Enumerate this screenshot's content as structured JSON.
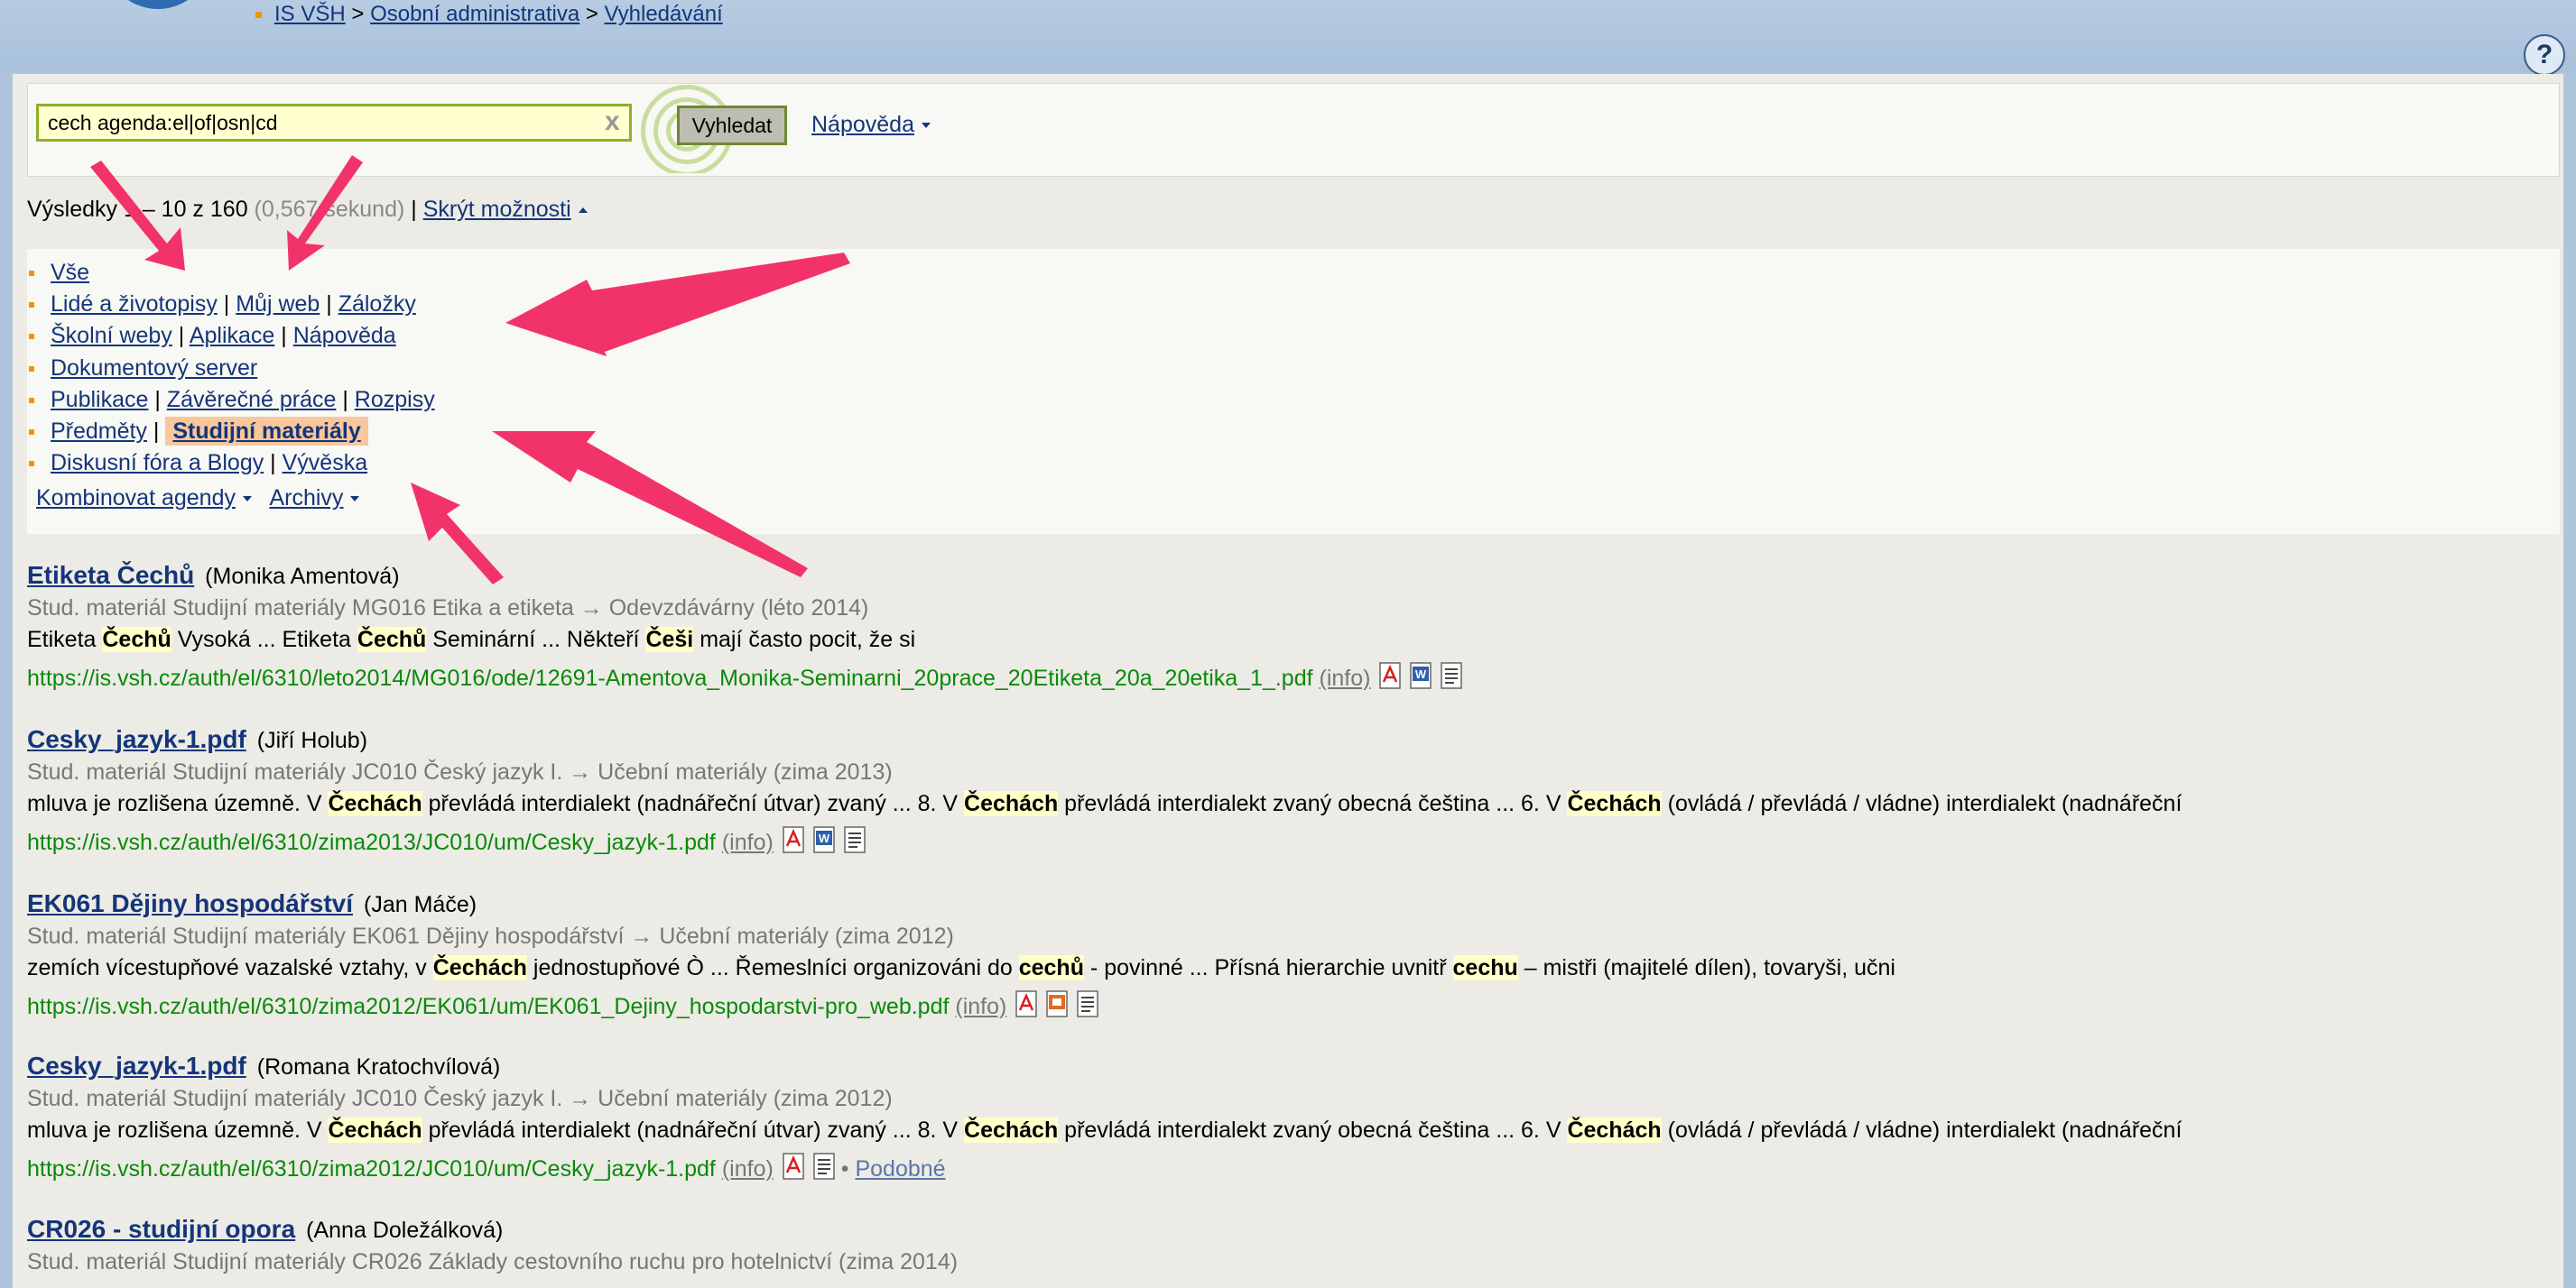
{
  "breadcrumb": {
    "items": [
      "IS VŠH",
      "Osobní administrativa",
      "Vyhledávání"
    ],
    "sep": ">"
  },
  "help_icon": "question-mark-icon",
  "search": {
    "value": "cech agenda:el|of|osn|cd",
    "clear": "x",
    "button": "Vyhledat",
    "help": "Nápověda"
  },
  "results_info": {
    "prefix": "Výsledky 1 – 10 z 160",
    "time": "(0,567 sekund)",
    "sep": "|",
    "toggle": "Skrýt možnosti"
  },
  "options": [
    {
      "links": [
        "Vše"
      ]
    },
    {
      "links": [
        "Lidé a životopisy",
        "Můj web",
        "Záložky"
      ]
    },
    {
      "links": [
        "Školní weby",
        "Aplikace",
        "Nápověda"
      ]
    },
    {
      "links": [
        "Dokumentový server"
      ]
    },
    {
      "links": [
        "Publikace",
        "Závěrečné práce",
        "Rozpisy"
      ]
    },
    {
      "links": [
        "Předměty",
        "Studijní materiály"
      ],
      "active": "Studijní materiály"
    },
    {
      "links": [
        "Diskusní fóra a Blogy",
        "Vývěska"
      ]
    }
  ],
  "combo": {
    "combine": "Kombinovat agendy",
    "archives": "Archivy"
  },
  "results": [
    {
      "title": "Etiketa Čechů",
      "author": "(Monika Amentová)",
      "meta": "Stud. materiál Studijní materiály MG016 Etika a etiketa → Odevzdávárny (léto 2014)",
      "snippet": [
        [
          "Etiketa ",
          false
        ],
        [
          "Čechů",
          true
        ],
        [
          " Vysoká ... Etiketa ",
          false
        ],
        [
          "Čechů",
          true
        ],
        [
          " Seminární ... Někteří ",
          false
        ],
        [
          "Češi",
          true
        ],
        [
          " mají často pocit, že si",
          false
        ]
      ],
      "url": "https://is.vsh.cz/auth/el/6310/leto2014/MG016/ode/12691-Amentova_Monika-Seminarni_20prace_20Etiketa_20a_20etika_1_.pdf",
      "info": "(info)",
      "icons": [
        "pdf-icon",
        "word-icon",
        "text-icon"
      ],
      "similar": ""
    },
    {
      "title": "Cesky_jazyk-1.pdf",
      "author": "(Jiří Holub)",
      "meta": "Stud. materiál Studijní materiály JC010 Český jazyk I. → Učební materiály (zima 2013)",
      "snippet": [
        [
          "mluva je rozlišena územně. V ",
          false
        ],
        [
          "Čechách",
          true
        ],
        [
          " převládá interdialekt (nadnářeční útvar) zvaný ... 8. V ",
          false
        ],
        [
          "Čechách",
          true
        ],
        [
          " převládá interdialekt zvaný obecná čeština ... 6. V ",
          false
        ],
        [
          "Čechách",
          true
        ],
        [
          " (ovládá / převládá / vládne) interdialekt (nadnářeční",
          false
        ]
      ],
      "url": "https://is.vsh.cz/auth/el/6310/zima2013/JC010/um/Cesky_jazyk-1.pdf",
      "info": "(info)",
      "icons": [
        "pdf-icon",
        "word-icon",
        "text-icon"
      ],
      "similar": ""
    },
    {
      "title": "EK061 Dějiny hospodářství",
      "author": "(Jan Máče)",
      "meta": "Stud. materiál Studijní materiály EK061 Dějiny hospodářství → Učební materiály (zima 2012)",
      "snippet": [
        [
          "zemích vícestupňové vazalské vztahy, v ",
          false
        ],
        [
          "Čechách",
          true
        ],
        [
          " jednostupňové Ò ... Řemeslníci organizováni do ",
          false
        ],
        [
          "cechů",
          true
        ],
        [
          " - povinné ... Přísná hierarchie uvnitř ",
          false
        ],
        [
          "cechu",
          true
        ],
        [
          " – mistři (majitelé dílen), tovaryši, učni",
          false
        ]
      ],
      "url": "https://is.vsh.cz/auth/el/6310/zima2012/EK061/um/EK061_Dejiny_hospodarstvi-pro_web.pdf",
      "info": "(info)",
      "icons": [
        "pdf-icon",
        "ppt-icon",
        "text-icon"
      ],
      "similar": ""
    },
    {
      "title": "Cesky_jazyk-1.pdf",
      "author": "(Romana Kratochvílová)",
      "meta": "Stud. materiál Studijní materiály JC010 Český jazyk I. → Učební materiály (zima 2012)",
      "snippet": [
        [
          "mluva je rozlišena územně. V ",
          false
        ],
        [
          "Čechách",
          true
        ],
        [
          " převládá interdialekt (nadnářeční útvar) zvaný ... 8. V ",
          false
        ],
        [
          "Čechách",
          true
        ],
        [
          " převládá interdialekt zvaný obecná čeština ... 6. V ",
          false
        ],
        [
          "Čechách",
          true
        ],
        [
          " (ovládá / převládá / vládne) interdialekt (nadnářeční",
          false
        ]
      ],
      "url": "https://is.vsh.cz/auth/el/6310/zima2012/JC010/um/Cesky_jazyk-1.pdf",
      "info": "(info)",
      "icons": [
        "pdf-icon",
        "text-icon"
      ],
      "similar": "Podobné"
    },
    {
      "title": "CR026 - studijní opora",
      "author": "(Anna Doležálková)",
      "meta": "Stud. materiál Studijní materiály CR026 Základy cestovního ruchu pro hotelnictví (zima 2014)",
      "snippet": [],
      "url": "",
      "info": "",
      "icons": [],
      "similar": ""
    }
  ],
  "colors": {
    "accent_link": "#14357a",
    "url_green": "#0a8a0a",
    "highlight": "#ffffc8",
    "arrow": "#f2336a",
    "bullet": "#f29400"
  }
}
